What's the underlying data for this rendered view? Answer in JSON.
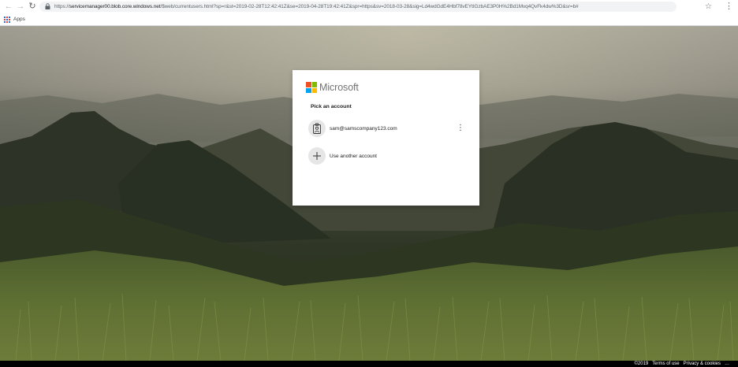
{
  "browser": {
    "back_icon": "arrow-left-icon",
    "forward_icon": "arrow-right-icon",
    "reload_icon": "reload-icon",
    "url_scheme": "https://",
    "url_host": "servicemanager00.blob.core.windows.net",
    "url_rest": "/$web/currentusers.html?sp=r&st=2019-02-28T12:42:41Z&se=2019-04-28T19:42:41Z&spr=https&sv=2018-03-28&sig=Ld4wdGdE4Hbf78vEYtIGzbAE3P0H%2Bd1Mvq4QvFk4dw%3D&sr=b#",
    "bookmark_icon": "star-icon",
    "menu_icon": "kebab-menu-icon",
    "bookmarks_bar": {
      "apps_label": "Apps"
    }
  },
  "dialog": {
    "brand": "Microsoft",
    "brand_colors": [
      "#f25022",
      "#7fba00",
      "#00a4ef",
      "#ffb900"
    ],
    "heading": "Pick an account",
    "accounts": [
      {
        "email": "sam@samscompany123.com",
        "icon": "work-badge-icon"
      }
    ],
    "use_another_label": "Use another account",
    "use_another_icon": "plus-icon"
  },
  "footer": {
    "copyright": "©2019",
    "terms": "Terms of use",
    "privacy": "Privacy & cookies",
    "more_icon": "ellipsis-icon"
  }
}
